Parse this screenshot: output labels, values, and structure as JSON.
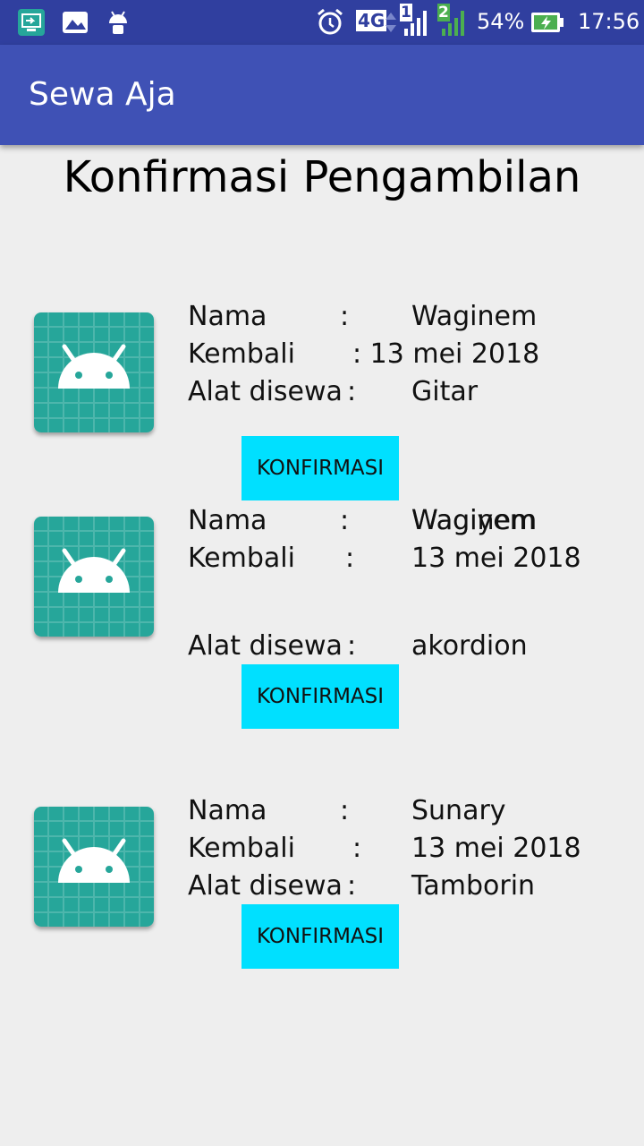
{
  "status_bar": {
    "battery": "54%",
    "time": "17:56",
    "network": "4G",
    "sim1": "1",
    "sim2": "2"
  },
  "app_bar": {
    "title": "Sewa Aja"
  },
  "page": {
    "title": "Konfirmasi Pengambilan"
  },
  "labels": {
    "nama": "Nama",
    "kembali": "Kembali",
    "alat": "Alat disewa",
    "colon": ":"
  },
  "items": [
    {
      "nama": "Waginem",
      "kembali_combined": ": 13 mei 2018",
      "alat": "Gitar",
      "button": "KONFIRMASI"
    },
    {
      "nama": "Waginem",
      "nama_overlap": "Wagiyem",
      "kembali": "13 mei 2018",
      "alat": "akordion",
      "button": "KONFIRMASI"
    },
    {
      "nama": "Sunary",
      "kembali": "13 mei 2018",
      "alat": "Tamborin",
      "button": "KONFIRMASI"
    }
  ]
}
